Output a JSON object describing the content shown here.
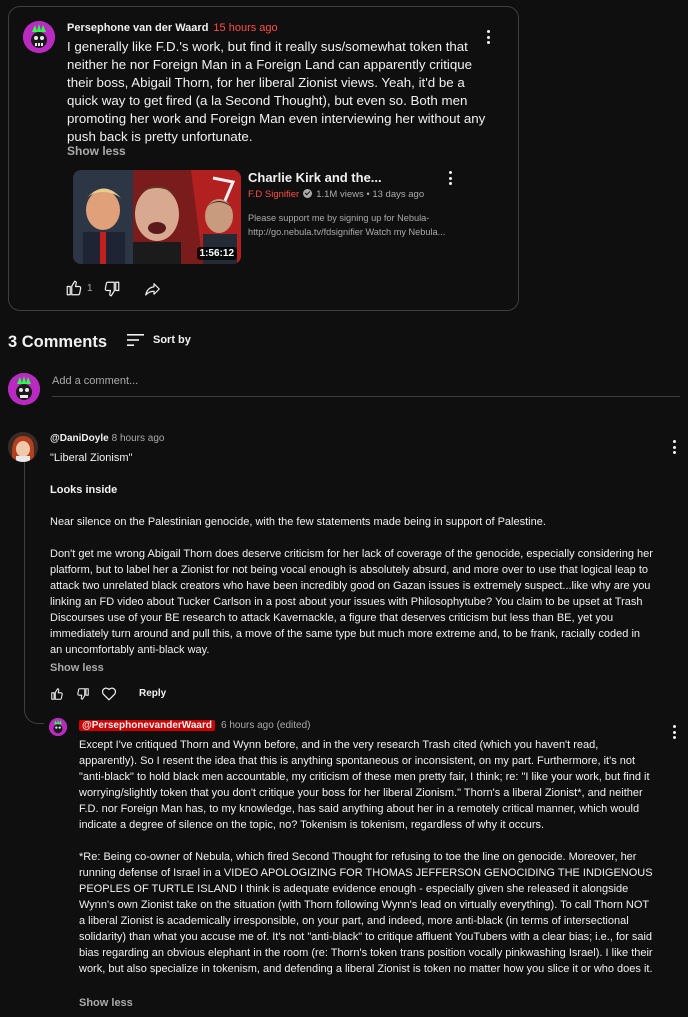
{
  "post": {
    "author": "Persephone van der Waard",
    "time": "15 hours ago",
    "text": "I generally like F.D.'s work, but find it really sus/somewhat token that neither he nor Foreign Man in a Foreign Land can apparently critique their boss, Abigail Thorn, for her liberal Zionist views. Yeah, it'd be a quick way to get fired (a la Second Thought), but even so. Both men promoting her work and Foreign Man even interviewing her without any push back is pretty unfortunate.",
    "show_less": "Show less",
    "like_count": "1",
    "video": {
      "title": "Charlie Kirk and the...",
      "channel": "F.D Signifier",
      "views": "1.1M views",
      "age": "13 days ago",
      "description": "Please support me by signing up for Nebula- http://go.nebula.tv/fdsignifier Watch my Nebula...",
      "duration": "1:56:12"
    }
  },
  "comments_header": {
    "count_label": "3 Comments",
    "sort_label": "Sort by",
    "add_placeholder": "Add a comment..."
  },
  "comments": [
    {
      "author": "@DaniDoyle",
      "time": "8 hours ago",
      "paragraphs": [
        "\"Liberal Zionism\"",
        "Looks inside",
        "Near silence on the Palestinian genocide, with the few statements made being in support of Palestine.",
        "Don't get me wrong Abigail Thorn does deserve criticism for her lack of coverage of the genocide, especially considering her platform, but to label her a Zionist for not being vocal enough is absolutely absurd, and more over to use that logical leap to attack two unrelated black creators who have been incredibly good on Gazan issues is extremely suspect...like why are you linking an FD video about Tucker Carlson in a post about your issues with Philosophytube? You claim to be upset at Trash Discourses use of your BE research to attack Kavernackle, a figure that deserves criticism but less than BE, yet you immediately turn around and pull this, a move of the same type but much more extreme and, to be frank, racially coded in an uncomfortably anti-black way."
      ],
      "show_less": "Show less",
      "reply_label": "Reply"
    },
    {
      "author": "@PersephonevanderWaard",
      "time": "6 hours ago (edited)",
      "paragraphs": [
        "Except I've critiqued Thorn and Wynn before, and in the very research Trash cited (which you haven't read, apparently). So I resent the idea that this is anything spontaneous or inconsistent, on my part. Furthermore, it's not \"anti-black\" to hold black men accountable, my criticism of these men pretty fair, I think; re: \"I like your work, but find it worrying/slightly token that you don't critique your boss for her liberal Zionism.\" Thorn's a liberal Zionist*, and neither F.D. nor Foreign Man has, to my knowledge, has said anything about her in a remotely critical manner, which would indicate a degree of silence on the topic, no? Tokenism is tokenism, regardless of why it occurs.",
        "*Re: Being co-owner of Nebula, which fired Second Thought for refusing to toe the line on genocide. Moreover, her running defense of Israel in a VIDEO APOLOGIZING FOR THOMAS JEFFERSON GENOCIDING THE INDIGENOUS PEOPLES OF TURTLE ISLAND I think is adequate evidence enough - especially given she released it alongside Wynn's own Zionist take on the situation (with Thorn following Wynn's lead on virtually everything). To call Thorn NOT a liberal Zionist is academically irresponsible, on your part, and indeed, more anti-black (in terms of intersectional solidarity) than what you accuse me of. It's not \"anti-black\" to critique affluent YouTubers with a clear bias; i.e., for said bias regarding an obvious elephant in the room (re: Thorn's token trans position vocally pinkwashing Israel). I like their work, but also specialize in tokenism, and defending a liberal Zionist is token no matter how you slice it or who does it."
      ],
      "show_less": "Show less"
    }
  ]
}
